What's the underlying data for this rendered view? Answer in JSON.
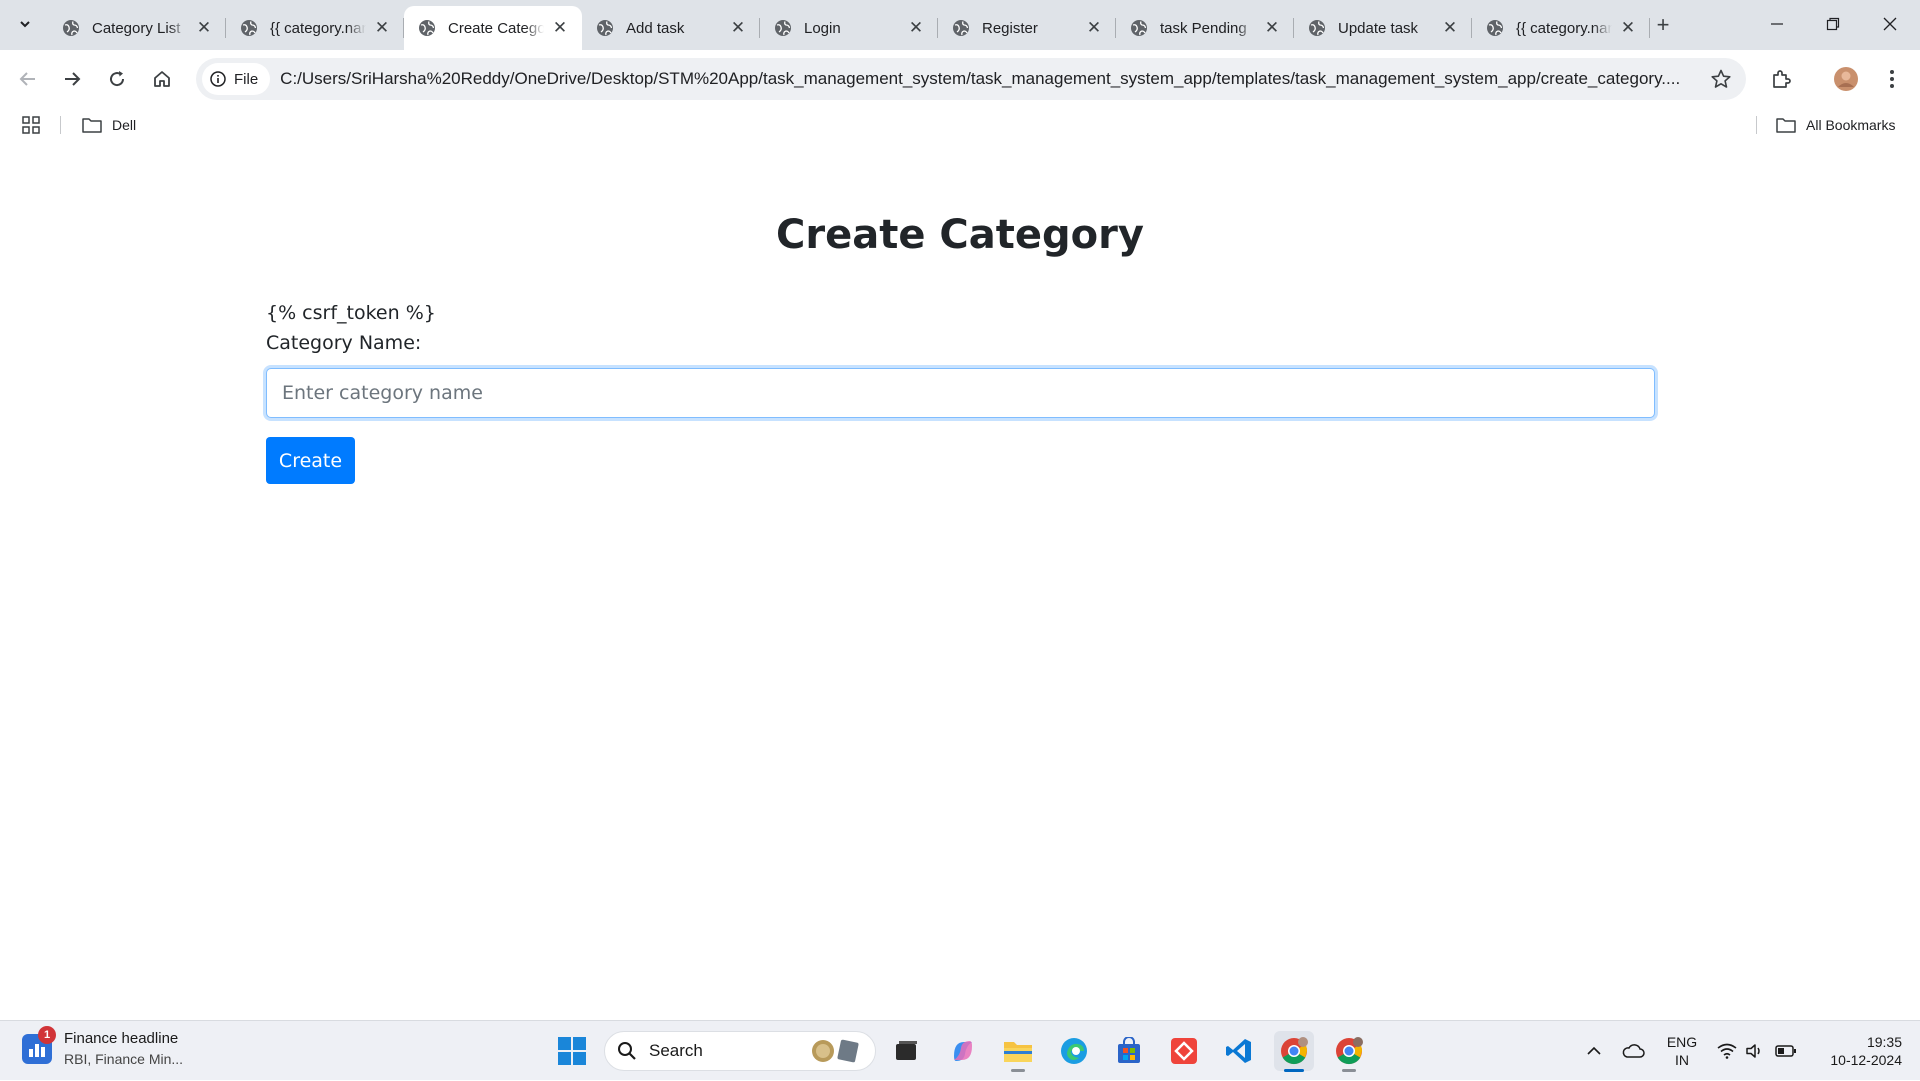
{
  "browser": {
    "tabs": [
      {
        "label": "Category List",
        "active": false
      },
      {
        "label": "{{ category.name }}",
        "active": false
      },
      {
        "label": "Create Category",
        "active": true
      },
      {
        "label": "Add task",
        "active": false
      },
      {
        "label": "Login",
        "active": false
      },
      {
        "label": "Register",
        "active": false
      },
      {
        "label": "task Pending",
        "active": false
      },
      {
        "label": "Update task",
        "active": false
      },
      {
        "label": "{{ category.name }}",
        "active": false
      }
    ],
    "close_glyph": "✕",
    "new_tab_glyph": "+",
    "site_chip": "File",
    "url": "C:/Users/SriHarsha%20Reddy/OneDrive/Desktop/STM%20App/task_management_system/task_management_system_app/templates/task_management_system_app/create_category....",
    "bookmarks": [
      {
        "label": "Dell"
      }
    ],
    "all_bookmarks_label": "All Bookmarks"
  },
  "page": {
    "title": "Create Category",
    "csrf_text": "{% csrf_token %}",
    "field_label": "Category Name:",
    "input_placeholder": "Enter category name",
    "input_value": "",
    "submit_label": "Create",
    "colors": {
      "primary": "#007bff",
      "focus_border": "#80bdff",
      "text": "#212529"
    }
  },
  "taskbar": {
    "widget_title": "Finance headline",
    "widget_subtitle": "RBI, Finance Min...",
    "widget_badge": "1",
    "search_label": "Search",
    "language_line1": "ENG",
    "language_line2": "IN",
    "time": "19:35",
    "date": "10-12-2024"
  }
}
